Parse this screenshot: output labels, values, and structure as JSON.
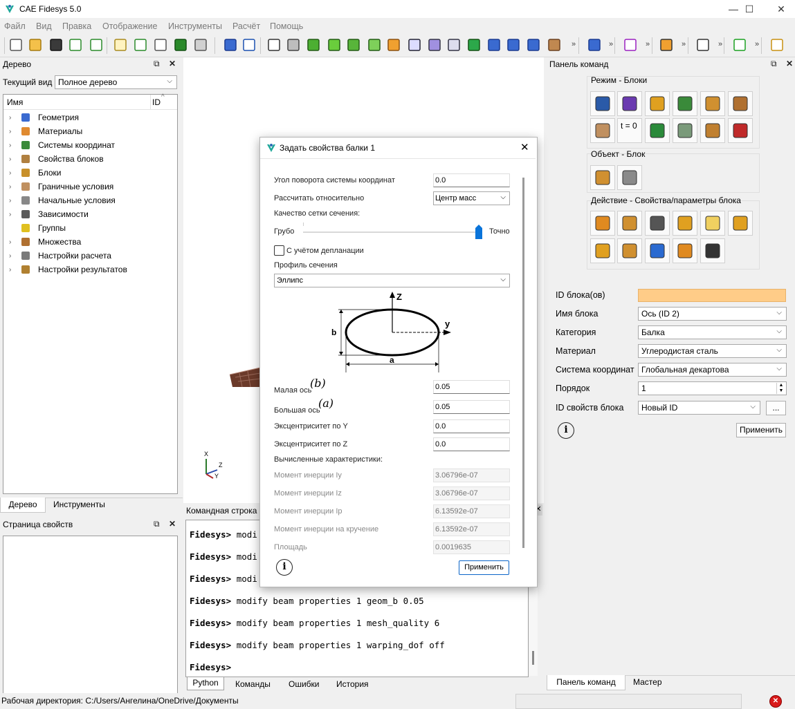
{
  "app": {
    "title": "CAE Fidesys 5.0",
    "window_controls": [
      "—",
      "☐",
      "✕"
    ]
  },
  "menu": [
    "Файл",
    "Вид",
    "Правка",
    "Отображение",
    "Инструменты",
    "Расчёт",
    "Помощь"
  ],
  "toolbar": {
    "overflow": "»"
  },
  "tree_panel": {
    "title": "Дерево",
    "view_label": "Текущий вид",
    "view_value": "Полное дерево",
    "col_name": "Имя",
    "col_id": "ID",
    "items": [
      {
        "label": "Геометрия",
        "icon": "geometry-icon",
        "expandable": true
      },
      {
        "label": "Материалы",
        "icon": "materials-icon",
        "expandable": true
      },
      {
        "label": "Системы координат",
        "icon": "coordinate-systems-icon",
        "expandable": true
      },
      {
        "label": "Свойства блоков",
        "icon": "block-properties-icon",
        "expandable": true
      },
      {
        "label": "Блоки",
        "icon": "blocks-icon",
        "expandable": true
      },
      {
        "label": "Граничные условия",
        "icon": "boundary-conditions-icon",
        "expandable": true
      },
      {
        "label": "Начальные условия",
        "icon": "initial-conditions-icon",
        "expandable": true
      },
      {
        "label": "Зависимости",
        "icon": "dependencies-icon",
        "expandable": true
      },
      {
        "label": "Группы",
        "icon": "groups-icon",
        "expandable": false
      },
      {
        "label": "Множества",
        "icon": "sets-icon",
        "expandable": true
      },
      {
        "label": "Настройки расчета",
        "icon": "calc-settings-icon",
        "expandable": true
      },
      {
        "label": "Настройки результатов",
        "icon": "result-settings-icon",
        "expandable": true
      }
    ],
    "tabs": [
      "Дерево",
      "Инструменты"
    ]
  },
  "props_panel": {
    "title": "Страница свойств"
  },
  "viewport": {
    "axis_labels": {
      "x": "X",
      "y": "Y",
      "z": "Z"
    }
  },
  "command_panel": {
    "title": "Панель команд",
    "group_mode": "Режим - Блоки",
    "group_object": "Объект - Блок",
    "group_action": "Действие - Свойства/параметры блока",
    "t0_label": "t = 0",
    "fields": {
      "block_ids_label": "ID блока(ов)",
      "block_ids_value": "",
      "block_name_label": "Имя блока",
      "block_name_value": "Ось (ID 2)",
      "category_label": "Категория",
      "category_value": "Балка",
      "material_label": "Материал",
      "material_value": "Углеродистая сталь",
      "coord_label": "Система координат",
      "coord_value": "Глобальная декартова",
      "order_label": "Порядок",
      "order_value": "1",
      "prop_id_label": "ID свойств блока",
      "prop_id_value": "Новый ID",
      "browse": "...",
      "apply": "Применить"
    },
    "tabs": [
      "Панель команд",
      "Мастер"
    ],
    "accent": "#ffcc88"
  },
  "command_line": {
    "title": "Командная строка",
    "prompt": "Fidesys>",
    "lines": [
      "modi",
      "modi",
      "modi",
      "modify beam properties 1 geom_b 0.05",
      "modify beam properties 1 mesh_quality 6",
      "modify beam properties 1 warping_dof off",
      ""
    ],
    "tabs": [
      "Python",
      "Команды",
      "Ошибки",
      "История"
    ]
  },
  "dialog": {
    "title": "Задать свойства балки 1",
    "rotation_label": "Угол поворота системы координат",
    "rotation_value": "0.0",
    "relative_label": "Рассчитать относительно",
    "relative_value": "Центр масс",
    "mesh_quality_label": "Качество сетки сечения:",
    "coarse": "Грубо",
    "fine": "Точно",
    "mesh_quality_fraction": 1.0,
    "warping_label": "С учётом депланации",
    "warping_checked": false,
    "profile_label": "Профиль сечения",
    "profile_value": "Эллипс",
    "diagram_labels": {
      "z": "Z",
      "y": "y",
      "b": "b",
      "a": "a"
    },
    "minor_label": "Малая ось",
    "minor_sym": "(b)",
    "minor_value": "0.05",
    "major_label": "Большая ось",
    "major_sym": "(a)",
    "major_value": "0.05",
    "ecc_y_label": "Эксцентриситет по Y",
    "ecc_y_value": "0.0",
    "ecc_z_label": "Эксцентриситет по Z",
    "ecc_z_value": "0.0",
    "computed_label": "Вычисленные характеристики:",
    "iy_label": "Момент инерции Iy",
    "iy_value": "3.06796e-07",
    "iz_label": "Момент инерции Iz",
    "iz_value": "3.06796e-07",
    "ip_label": "Момент инерции Ip",
    "ip_value": "6.13592e-07",
    "it_label": "Момент инерции на кручение",
    "it_value": "6.13592e-07",
    "area_label": "Площадь",
    "area_value": "0.0019635",
    "apply": "Применить"
  },
  "status_bar": {
    "workdir": "Рабочая директория: C:/Users/Ангелина/OneDrive/Документы"
  }
}
